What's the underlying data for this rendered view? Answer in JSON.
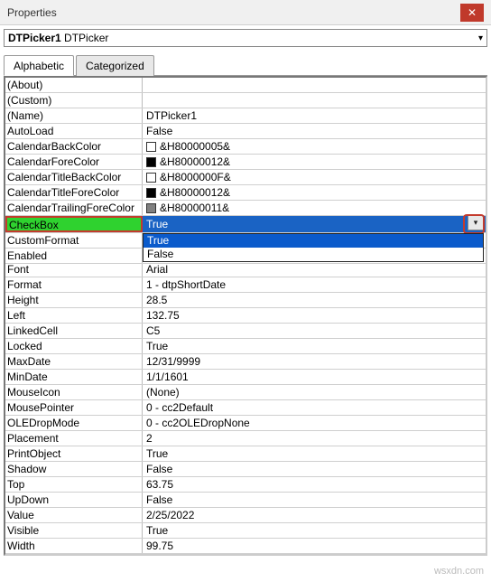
{
  "window": {
    "title": "Properties",
    "close": "✕"
  },
  "selector": {
    "name": "DTPicker1",
    "type": "DTPicker",
    "chev": "▾"
  },
  "tabs": {
    "alphabetic": "Alphabetic",
    "categorized": "Categorized"
  },
  "rows": [
    {
      "name": "(About)",
      "value": ""
    },
    {
      "name": "(Custom)",
      "value": ""
    },
    {
      "name": "(Name)",
      "value": "DTPicker1"
    },
    {
      "name": "AutoLoad",
      "value": "False"
    },
    {
      "name": "CalendarBackColor",
      "value": "&H80000005&",
      "swatch": "#ffffff"
    },
    {
      "name": "CalendarForeColor",
      "value": "&H80000012&",
      "swatch": "#000000"
    },
    {
      "name": "CalendarTitleBackColor",
      "value": "&H8000000F&",
      "swatch": "#ffffff"
    },
    {
      "name": "CalendarTitleForeColor",
      "value": "&H80000012&",
      "swatch": "#000000"
    },
    {
      "name": "CalendarTrailingForeColor",
      "value": "&H80000011&",
      "swatch": "#808080"
    }
  ],
  "checkbox": {
    "name": "CheckBox",
    "value": "True",
    "options": [
      "True",
      "False"
    ],
    "chev": "▾"
  },
  "rows2": [
    {
      "name": "CustomFormat",
      "value": ""
    },
    {
      "name": "Enabled",
      "value": ""
    },
    {
      "name": "Font",
      "value": "Arial"
    },
    {
      "name": "Format",
      "value": "1 - dtpShortDate"
    },
    {
      "name": "Height",
      "value": "28.5"
    },
    {
      "name": "Left",
      "value": "132.75"
    },
    {
      "name": "LinkedCell",
      "value": "C5"
    },
    {
      "name": "Locked",
      "value": "True"
    },
    {
      "name": "MaxDate",
      "value": "12/31/9999"
    },
    {
      "name": "MinDate",
      "value": "1/1/1601"
    },
    {
      "name": "MouseIcon",
      "value": "(None)"
    },
    {
      "name": "MousePointer",
      "value": "0 - cc2Default"
    },
    {
      "name": "OLEDropMode",
      "value": "0 - cc2OLEDropNone"
    },
    {
      "name": "Placement",
      "value": "2"
    },
    {
      "name": "PrintObject",
      "value": "True"
    },
    {
      "name": "Shadow",
      "value": "False"
    },
    {
      "name": "Top",
      "value": "63.75"
    },
    {
      "name": "UpDown",
      "value": "False"
    },
    {
      "name": "Value",
      "value": "2/25/2022"
    },
    {
      "name": "Visible",
      "value": "True"
    },
    {
      "name": "Width",
      "value": "99.75"
    }
  ],
  "watermark": "wsxdn.com"
}
